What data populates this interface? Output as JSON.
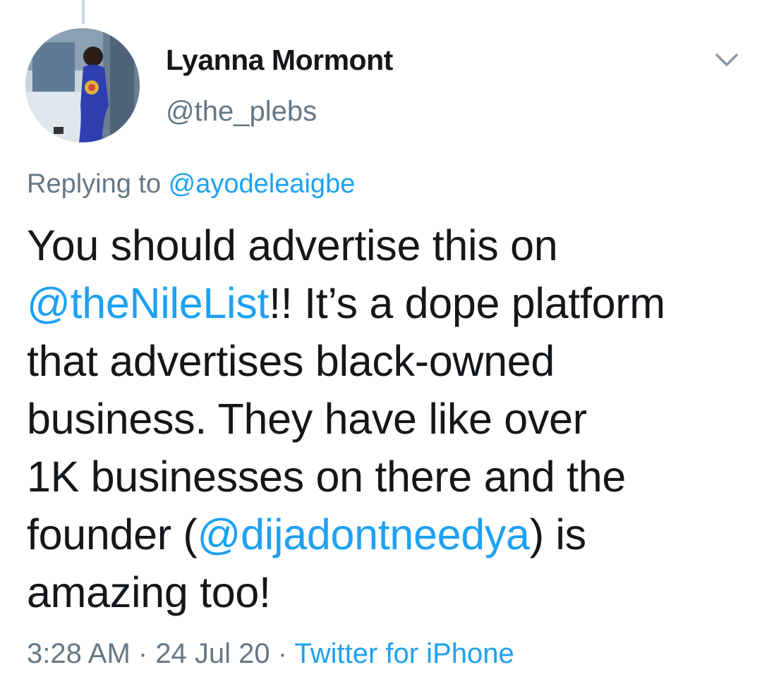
{
  "tweet": {
    "author": {
      "name": "Lyanna Mormont",
      "handle": "@the_plebs",
      "avatar_icon": "profile-photo"
    },
    "reply": {
      "prefix": "Replying to ",
      "mention": "@ayodeleaigbe"
    },
    "text": {
      "line1": "You should advertise this on",
      "line2_mention": "@theNileList",
      "line2_rest": "!! It’s a dope platform",
      "line3": "that advertises black-owned",
      "line4": "business. They have like over",
      "line5": "1K businesses on there and the",
      "line6_prefix": "founder (",
      "line6_mention": "@dijadontneedya",
      "line6_suffix": ") is",
      "line7": "amazing too!"
    },
    "meta": {
      "time": "3:28 AM",
      "sep1": " · ",
      "date": "24 Jul 20",
      "sep2": " · ",
      "source": "Twitter for iPhone"
    },
    "menu_icon": "chevron-down-icon"
  },
  "colors": {
    "link": "#1da1f2",
    "secondary": "#657786",
    "text": "#14171a"
  }
}
